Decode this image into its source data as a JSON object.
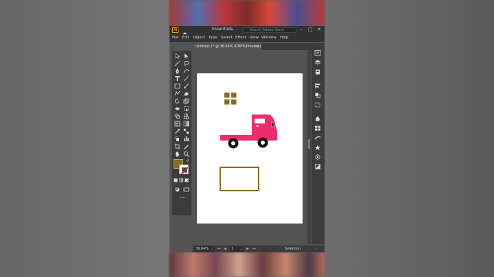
{
  "app": {
    "logo": "Ai",
    "workspace": "Essentials",
    "search_placeholder": "Search Adobe Stock",
    "window_controls": {
      "minimize": "–",
      "maximize": "□",
      "close": "✕"
    }
  },
  "menu": [
    "File",
    "Edit",
    "Object",
    "Type",
    "Select",
    "Effect",
    "View",
    "Window",
    "Help"
  ],
  "document_tab": {
    "label": "Untitled-1* @ 36.64% (CMYK/Preview)",
    "close": "×"
  },
  "colors": {
    "fill": "#8b6b1e",
    "truck": "#ef2c6b",
    "grid_icon": "#8b6b1e",
    "rectangle_stroke": "#8b6b1e"
  },
  "status": {
    "zoom": "36.64%",
    "page": "1",
    "tool": "Selection"
  },
  "icons": {
    "tools": [
      "selection-icon",
      "direct-selection-icon",
      "magic-wand-icon",
      "lasso-icon",
      "pen-icon",
      "curvature-icon",
      "type-icon",
      "line-segment-icon",
      "rectangle-icon",
      "paintbrush-icon",
      "shaper-icon",
      "eraser-icon",
      "rotate-icon",
      "scale-icon",
      "width-icon",
      "free-transform-icon",
      "shape-builder-icon",
      "perspective-grid-icon",
      "mesh-icon",
      "gradient-icon",
      "eyedropper-icon",
      "blend-icon",
      "symbol-sprayer-icon",
      "column-graph-icon",
      "artboard-icon",
      "slice-icon",
      "hand-icon",
      "zoom-icon"
    ],
    "panels": [
      "properties-icon",
      "layers-icon",
      "libraries-icon",
      "align-icon",
      "pathfinder-icon",
      "transform-icon",
      "color-icon",
      "swatches-icon",
      "brushes-icon",
      "symbols-icon",
      "appearance-icon",
      "graphic-styles-icon"
    ]
  }
}
